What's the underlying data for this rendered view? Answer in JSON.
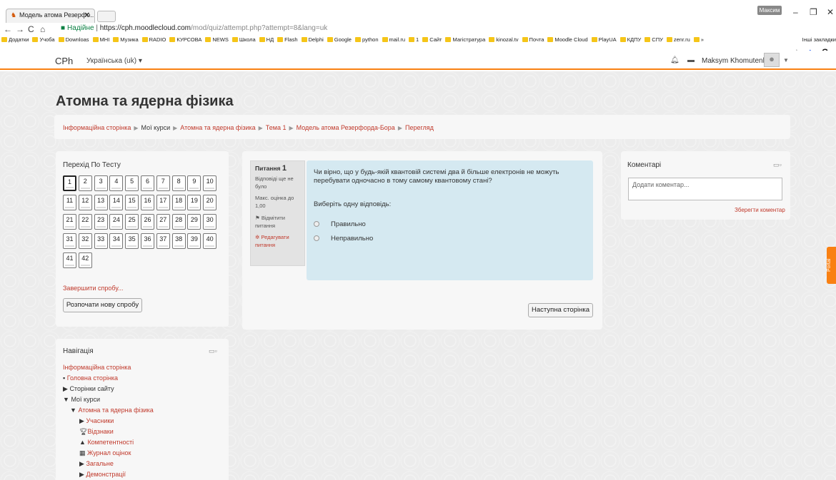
{
  "browser": {
    "tab_title": "Модель атома Резерфо...",
    "profile": "Максим",
    "secure_label": "Надійне",
    "url_host": "https://cph.moodlecloud.com",
    "url_path": "/mod/quiz/attempt.php?attempt=8&lang=uk",
    "bookmarks": [
      "Додатки",
      "Учоба",
      "Downloas",
      "МНІ",
      "Музика",
      "RADIO",
      "КУРСОВА",
      "NEWS",
      "Школа",
      "НД",
      "Flash",
      "Delphi",
      "Google",
      "python",
      "mail.ru",
      "1",
      "Сайт",
      "Магістратура",
      "kinozal.tv",
      "Почта",
      "Moodle Cloud",
      "PlayUA",
      "КДПУ",
      "СПУ",
      "zenr.ru",
      "»"
    ],
    "other_bookmarks": "Інші закладки"
  },
  "navbar": {
    "brand": "CPh",
    "language": "Українська (uk) ▾",
    "user_name": "Maksym Khomutenko"
  },
  "page": {
    "title": "Атомна та ядерна фізика",
    "breadcrumb": [
      "Інформаційна сторінка",
      "Мої курси",
      "Атомна та ядерна фізика",
      "Тема 1",
      "Модель атома Резерфорда-Бора",
      "Перегляд"
    ]
  },
  "quiz_nav": {
    "title": "Перехід По Тесту",
    "questions": [
      "1",
      "2",
      "3",
      "4",
      "5",
      "6",
      "7",
      "8",
      "9",
      "10",
      "11",
      "12",
      "13",
      "14",
      "15",
      "16",
      "17",
      "18",
      "19",
      "20",
      "21",
      "22",
      "23",
      "24",
      "25",
      "26",
      "27",
      "28",
      "29",
      "30",
      "31",
      "32",
      "33",
      "34",
      "35",
      "36",
      "37",
      "38",
      "39",
      "40",
      "41",
      "42"
    ],
    "current": "1",
    "finish_link": "Завершити спробу...",
    "new_attempt": "Розпочати нову спробу"
  },
  "question": {
    "label": "Питання",
    "number": "1",
    "status": "Відповіді ще не було",
    "max_grade": "Макс. оцінка до 1,00",
    "flag": "Відмітити питання",
    "edit": "Редагувати питання",
    "text": "Чи вірно, що у будь-якій квантовій системі два й більше електронів не можуть перебувати одночасно в тому самому квантовому стані?",
    "prompt": "Виберіть одну відповідь:",
    "options": [
      "Правильно",
      "Неправильно"
    ],
    "next": "Наступна сторінка"
  },
  "comments": {
    "title": "Коментарі",
    "placeholder": "Додати коментар...",
    "save": "Зберегти коментар"
  },
  "navigation": {
    "title": "Навігація",
    "home": "Інформаційна сторінка",
    "main_page": "Головна сторінка",
    "site_pages": "Сторінки сайту",
    "my_courses": "Мої курси",
    "course": "Атомна та ядерна фізика",
    "participants": "Учасники",
    "badges": "Відзнаки",
    "competencies": "Компетентності",
    "grades": "Журнал оцінок",
    "general": "Загальне",
    "demos": "Демонстрації"
  },
  "portal_tab": "Portal"
}
